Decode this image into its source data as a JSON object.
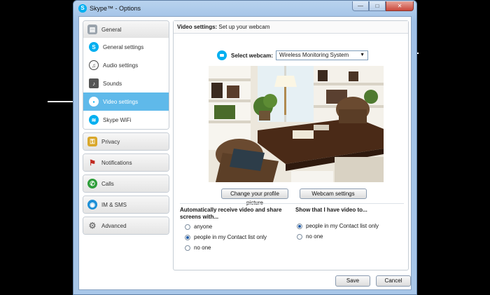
{
  "window": {
    "title": "Skype™ - Options",
    "minimize": "—",
    "maximize": "□",
    "close": "✕"
  },
  "sidebar": {
    "general": {
      "label": "General",
      "items": [
        {
          "label": "General settings",
          "icon": "skype-icon"
        },
        {
          "label": "Audio settings",
          "icon": "headset-icon"
        },
        {
          "label": "Sounds",
          "icon": "speaker-icon"
        },
        {
          "label": "Video settings",
          "icon": "webcam-icon",
          "active": true
        },
        {
          "label": "Skype WiFi",
          "icon": "wifi-icon"
        }
      ]
    },
    "groups": [
      {
        "label": "Privacy",
        "icon": "lock-icon"
      },
      {
        "label": "Notifications",
        "icon": "flag-icon"
      },
      {
        "label": "Calls",
        "icon": "phone-icon"
      },
      {
        "label": "IM & SMS",
        "icon": "chat-icon"
      },
      {
        "label": "Advanced",
        "icon": "gear-icon"
      }
    ]
  },
  "main": {
    "header_bold": "Video settings:",
    "header_rest": " Set up your webcam",
    "webcam_label": "Select webcam:",
    "webcam_value": "Wireless Monitoring System",
    "change_picture": "Change your profile picture",
    "webcam_settings": "Webcam settings",
    "receive_title": "Automatically receive video and share screens with...",
    "receive_options": [
      {
        "label": "anyone",
        "checked": false
      },
      {
        "label": "people in my Contact list only",
        "checked": true
      },
      {
        "label": "no one",
        "checked": false
      }
    ],
    "show_title": "Show that I have video to...",
    "show_options": [
      {
        "label": "people in my Contact list only",
        "checked": true
      },
      {
        "label": "no one",
        "checked": false
      }
    ]
  },
  "footer": {
    "save": "Save",
    "cancel": "Cancel"
  },
  "colors": {
    "accent": "#00aff0",
    "active_item": "#5fb9ea",
    "window_frame": "#a8c6e8"
  }
}
